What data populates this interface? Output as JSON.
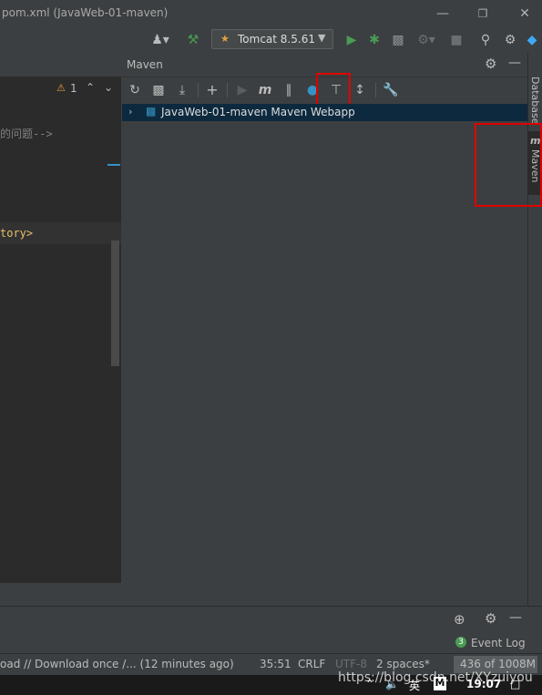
{
  "window": {
    "title": "pom.xml (JavaWeb-01-maven)"
  },
  "toolbar": {
    "run_config": "Tomcat 8.5.61"
  },
  "editor": {
    "warning_count": "1",
    "code_lines": [
      "的问题-->",
      "tory>"
    ]
  },
  "maven": {
    "title": "Maven",
    "project": "JavaWeb-01-maven Maven Webapp"
  },
  "right_strip": {
    "database": "Database",
    "maven": "Maven"
  },
  "bottom": {
    "event_log_count": "3",
    "event_log": "Event Log"
  },
  "status": {
    "message": "oad // Download once /... (12 minutes ago)",
    "position": "35:51",
    "line_sep": "CRLF",
    "encoding": "UTF-8",
    "indent": "2 spaces*",
    "memory": "436 of 1008M"
  },
  "taskbar": {
    "watermark": "https://blog.csdn.net/XYzuiyou",
    "ime": "英",
    "time": "19:07"
  },
  "colors": {
    "highlight_red": "#e00000",
    "selection": "#0d293e",
    "run_green": "#499c54"
  }
}
